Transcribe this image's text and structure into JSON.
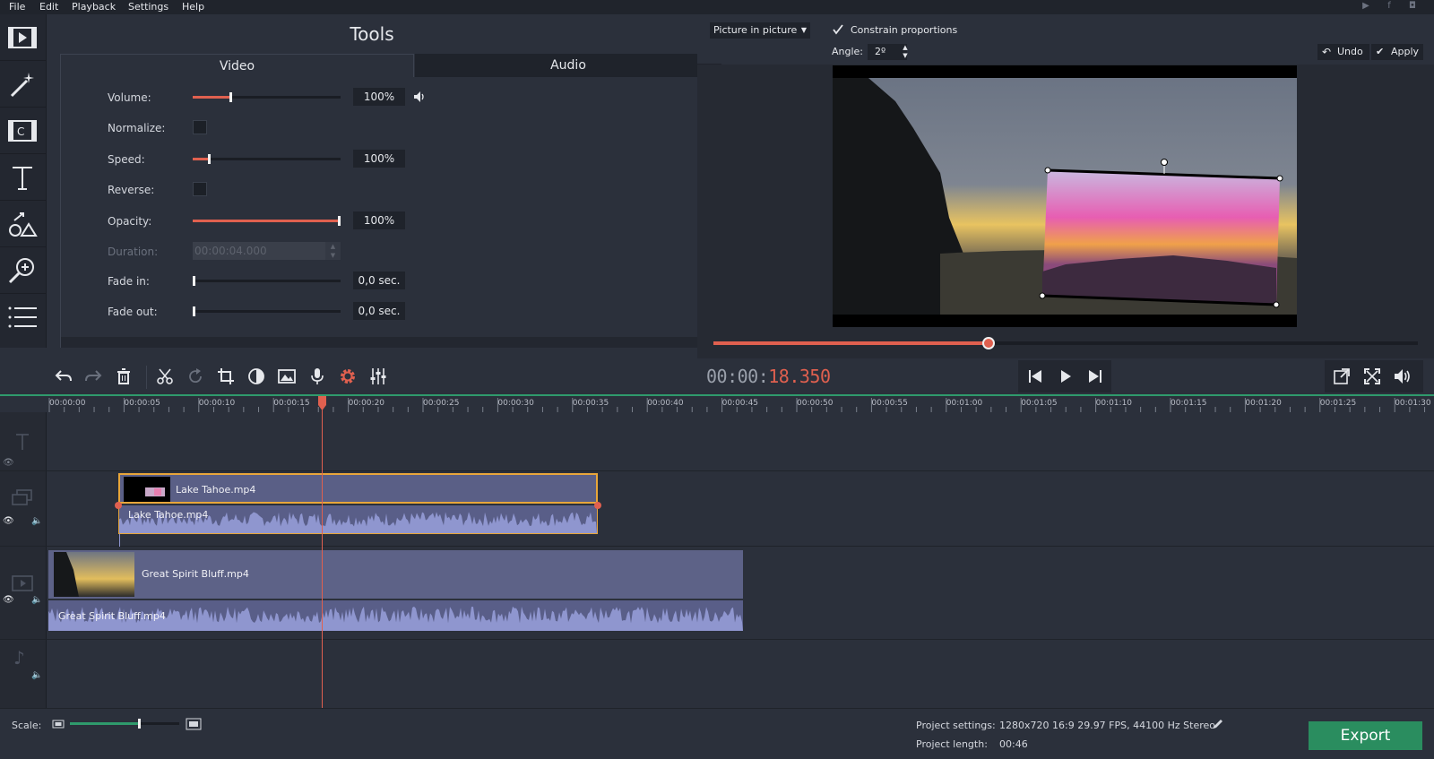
{
  "menu": [
    "File",
    "Edit",
    "Playback",
    "Settings",
    "Help"
  ],
  "tools": {
    "title": "Tools",
    "tabs": [
      "Video",
      "Audio"
    ],
    "volume": {
      "label": "Volume:",
      "value": "100%",
      "level": 0.25
    },
    "normalize": {
      "label": "Normalize:"
    },
    "speed": {
      "label": "Speed:",
      "value": "100%",
      "level": 0.1
    },
    "reverse": {
      "label": "Reverse:"
    },
    "opacity": {
      "label": "Opacity:",
      "value": "100%",
      "level": 1.0
    },
    "duration": {
      "label": "Duration:",
      "value": "00:00:04.000"
    },
    "fade_in": {
      "label": "Fade in:",
      "value": "0,0 sec.",
      "level": 0.0
    },
    "fade_out": {
      "label": "Fade out:",
      "value": "0,0 sec.",
      "level": 0.0
    }
  },
  "preview": {
    "mode": "Picture in picture",
    "constrain": "Constrain proportions",
    "angle_label": "Angle:",
    "angle_value": "2º",
    "undo": "Undo",
    "apply": "Apply",
    "timecode_white": "00:00:",
    "timecode_red": "18.350",
    "seek_progress": 0.39
  },
  "timeline": {
    "ticks": [
      "00:00:00",
      "00:00:05",
      "00:00:10",
      "00:00:15",
      "00:00:20",
      "00:00:25",
      "00:00:30",
      "00:00:35",
      "00:00:40",
      "00:00:45",
      "00:00:50",
      "00:00:55",
      "00:01:00",
      "00:01:05",
      "00:01:10",
      "00:01:15",
      "00:01:20",
      "00:01:25",
      "00:01:30"
    ],
    "clips": {
      "overlay_video": "Lake Tahoe.mp4",
      "overlay_audio": "Lake Tahoe.mp4",
      "main_video": "Great Spirit Bluff.mp4",
      "main_audio": "Great Spirit Bluff.mp4"
    }
  },
  "status": {
    "scale_label": "Scale:",
    "scale_level": 0.62,
    "project_settings_label": "Project settings:",
    "project_settings_value": "1280x720 16:9 29.97 FPS, 44100 Hz Stereo",
    "project_length_label": "Project length:",
    "project_length_value": "00:46",
    "export": "Export"
  },
  "colors": {
    "accent": "#e0604f",
    "export": "#2a8d5f",
    "clip": "#5a5f86",
    "selection": "#e8a63a"
  }
}
